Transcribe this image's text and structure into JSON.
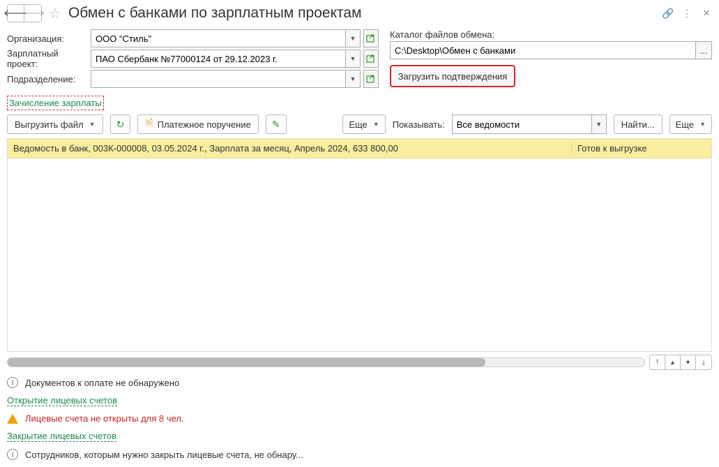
{
  "title": "Обмен с банками по зарплатным проектам",
  "labels": {
    "organization": "Организация:",
    "salaryProject": "Зарплатный проект:",
    "subdivision": "Подразделение:",
    "exchangeCatalog": "Каталог файлов обмена:",
    "show": "Показывать:"
  },
  "values": {
    "organization": "ООО \"Стиль\"",
    "salaryProject": "ПАО Сбербанк №77000124 от 29.12.2023 г.",
    "subdivision": "",
    "exchangePath": "C:\\Desktop\\Обмен с банками",
    "showFilter": "Все ведомости"
  },
  "buttons": {
    "loadConfirmations": "Загрузить подтверждения",
    "exportFile": "Выгрузить файл",
    "paymentOrder": "Платежное поручение",
    "more": "Еще",
    "find": "Найти...",
    "pathBrowse": "..."
  },
  "tab": "Зачисление зарплаты",
  "grid": {
    "rows": [
      {
        "text": "Ведомость в банк, 003К-000008, 03.05.2024 г., Зарплата за месяц, Апрель 2024, 633 800,00",
        "status": "Готов к выгрузке"
      }
    ]
  },
  "footer": {
    "noDocs": "Документов к оплате не обнаружено",
    "openAccounts": "Открытие лицевых счетов",
    "accountsWarn": "Лицевые счета не открыты для 8 чел.",
    "closeAccounts": "Закрытие лицевых счетов",
    "noEmployees": "Сотрудников, которым нужно закрыть лицевые счета, не обнару..."
  }
}
